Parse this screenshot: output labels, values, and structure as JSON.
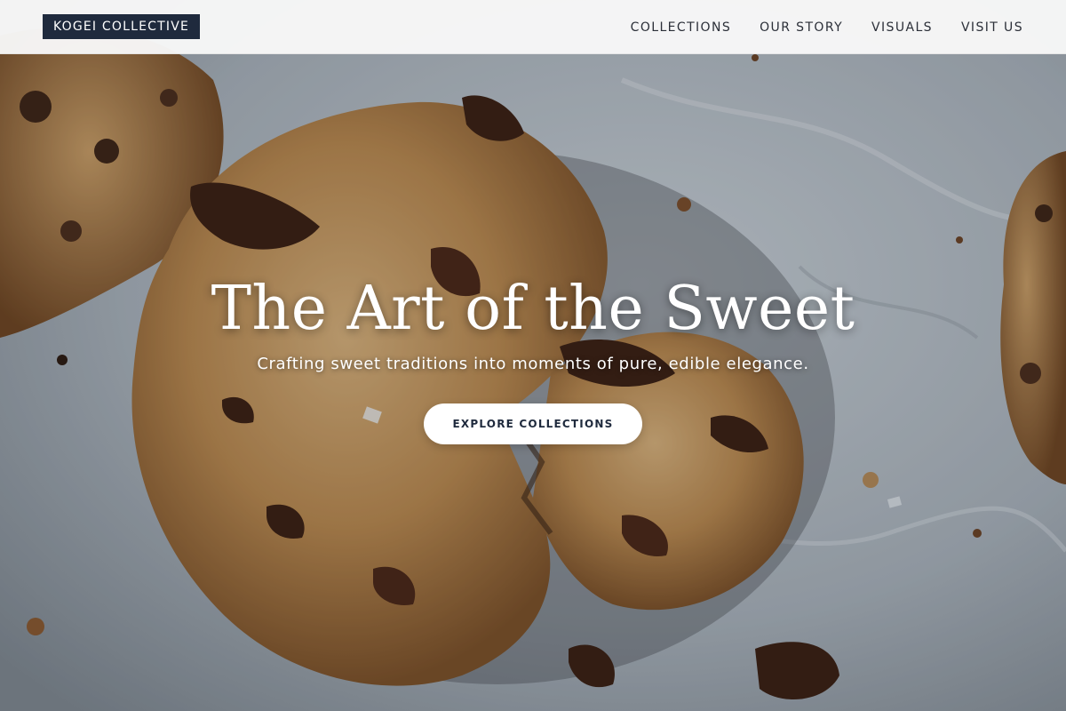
{
  "header": {
    "logo_text": "KOGEI COLLECTIVE",
    "nav": [
      {
        "label": "COLLECTIONS"
      },
      {
        "label": "OUR STORY"
      },
      {
        "label": "VISUALS"
      },
      {
        "label": "VISIT US"
      }
    ]
  },
  "hero": {
    "title": "The Art of the Sweet",
    "subtitle": "Crafting sweet traditions into moments of pure, edible elegance.",
    "cta_label": "EXPLORE COLLECTIONS",
    "background": "chocolate-chip-cookies-photo"
  },
  "colors": {
    "logo_bg": "#1f2a3d",
    "header_bg": "#f8f8f8",
    "cta_bg": "#ffffff",
    "cta_text": "#1f2a3d"
  }
}
